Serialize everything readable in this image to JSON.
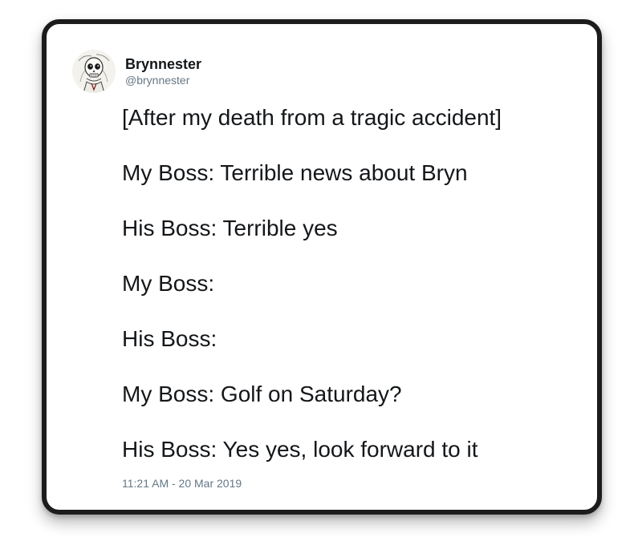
{
  "tweet": {
    "author": {
      "display_name": "Brynnester",
      "handle": "@brynnester",
      "avatar_icon": "skeleton-sketch-avatar"
    },
    "lines": [
      "[After my death from a tragic accident]",
      "My Boss: Terrible news about Bryn",
      "His Boss: Terrible yes",
      "My Boss:",
      "His Boss:",
      "My Boss: Golf on Saturday?",
      "His Boss: Yes yes, look forward to it"
    ],
    "timestamp": "11:21 AM - 20 Mar 2019"
  },
  "colors": {
    "text_primary": "#14171a",
    "text_secondary": "#657786",
    "frame": "#1c1c1c"
  }
}
